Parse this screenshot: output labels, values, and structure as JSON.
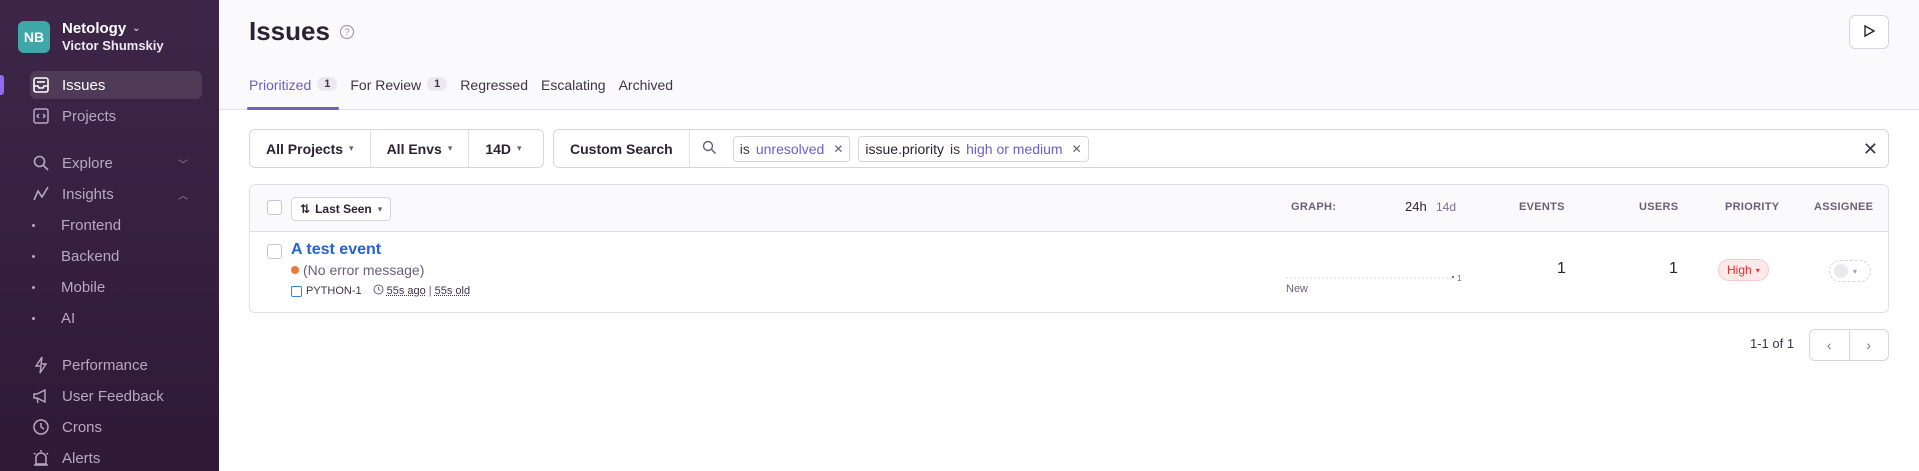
{
  "org": {
    "initials": "NB",
    "name": "Netology",
    "user": "Victor Shumskiy"
  },
  "sidebar": {
    "items": [
      {
        "label": "Issues",
        "icon": "inbox-icon"
      },
      {
        "label": "Projects",
        "icon": "code-icon"
      },
      {
        "label": "Explore",
        "icon": "search-icon"
      },
      {
        "label": "Insights",
        "icon": "graph-icon"
      },
      {
        "label": "Performance",
        "icon": "bolt-icon"
      },
      {
        "label": "User Feedback",
        "icon": "megaphone-icon"
      },
      {
        "label": "Crons",
        "icon": "clock-icon"
      },
      {
        "label": "Alerts",
        "icon": "siren-icon"
      }
    ],
    "insights_sub": [
      "Frontend",
      "Backend",
      "Mobile",
      "AI"
    ]
  },
  "page": {
    "title": "Issues",
    "help": "?"
  },
  "tabs": [
    {
      "label": "Prioritized",
      "count": "1"
    },
    {
      "label": "For Review",
      "count": "1"
    },
    {
      "label": "Regressed"
    },
    {
      "label": "Escalating"
    },
    {
      "label": "Archived"
    }
  ],
  "filters": {
    "projects": "All Projects",
    "envs": "All Envs",
    "period": "14D"
  },
  "search": {
    "custom_label": "Custom Search",
    "tokens": [
      {
        "key": "",
        "op": "is",
        "value": "unresolved"
      },
      {
        "key": "issue.priority",
        "op": "is",
        "value": "high or medium"
      }
    ]
  },
  "table": {
    "sort_label": "Last Seen",
    "headers": {
      "graph": "GRAPH:",
      "period_24h": "24h",
      "period_14d": "14d",
      "events": "EVENTS",
      "users": "USERS",
      "priority": "PRIORITY",
      "assignee": "ASSIGNEE"
    },
    "rows": [
      {
        "title": "A test event",
        "message": "(No error message)",
        "short_id": "PYTHON-1",
        "last_seen": "55s ago",
        "age": "55s old",
        "graph_max": "1",
        "graph_label": "New",
        "events": "1",
        "users": "1",
        "priority": "High"
      }
    ]
  },
  "pagination": {
    "text": "1-1 of 1"
  },
  "colors": {
    "accent": "#6c5fc7",
    "sidebar": "#3e2648",
    "link": "#2562d4",
    "priority_high": "#d33333"
  }
}
